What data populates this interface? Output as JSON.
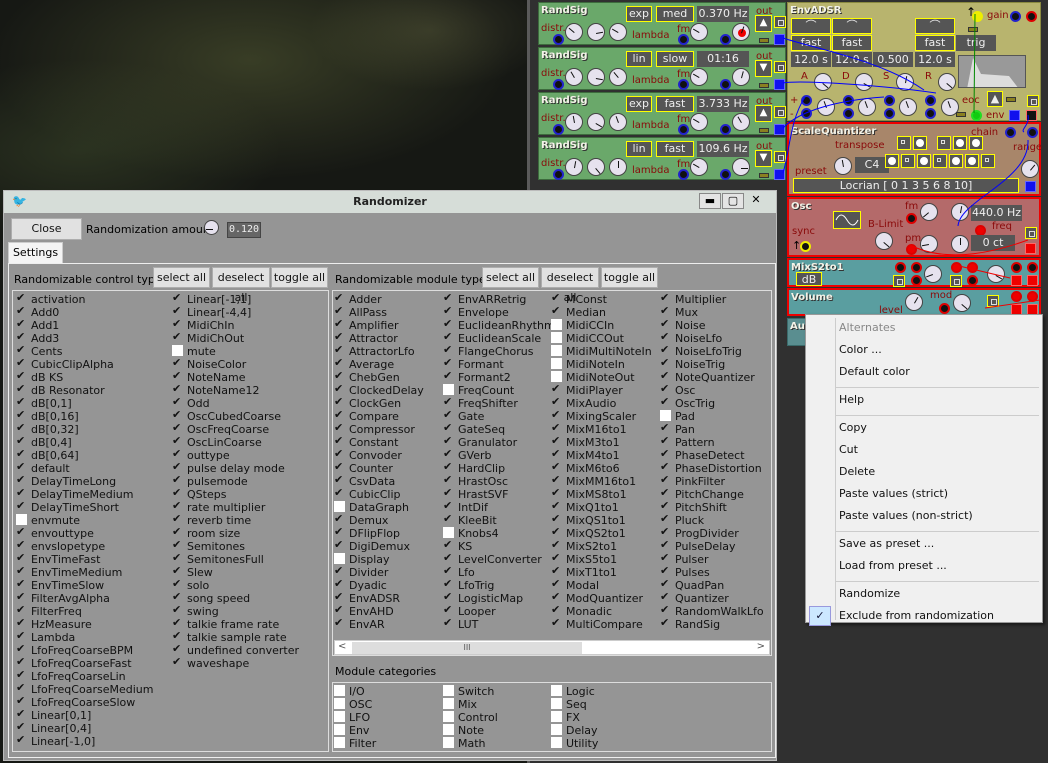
{
  "randsig": [
    {
      "title": "RandSig",
      "dist": "exp",
      "speed": "med",
      "value": "0.370 Hz",
      "distr": "distr.",
      "lambda": "lambda",
      "fm": "fm",
      "out": "out"
    },
    {
      "title": "RandSig",
      "dist": "lin",
      "speed": "slow",
      "value": "01:16",
      "distr": "distr.",
      "lambda": "lambda",
      "fm": "fm",
      "out": "out"
    },
    {
      "title": "RandSig",
      "dist": "exp",
      "speed": "fast",
      "value": "3.733 Hz",
      "distr": "distr.",
      "lambda": "lambda",
      "fm": "fm",
      "out": "out"
    },
    {
      "title": "RandSig",
      "dist": "lin",
      "speed": "fast",
      "value": "109.6 Hz",
      "distr": "distr.",
      "lambda": "lambda",
      "fm": "fm",
      "out": "out"
    }
  ],
  "envadsr": {
    "title": "EnvADSR",
    "modes": [
      "fast",
      "fast",
      "fast"
    ],
    "trig": "trig",
    "values": [
      "12.0 s",
      "12.0 s",
      "0.500",
      "12.0 s"
    ],
    "labels": [
      "A",
      "D",
      "S",
      "R"
    ],
    "gain": "gain",
    "eoc": "eoc",
    "env": "env",
    "plus": "+",
    "minus": "-"
  },
  "scalequantizer": {
    "title": "ScaleQuantizer",
    "chain": "chain",
    "transpose": "transpose",
    "note": "C4",
    "preset": "preset",
    "range": "range",
    "scale": "Locrian [ 0 1 3 5 6 8 10]"
  },
  "osc": {
    "title": "Osc",
    "blimit": "B-Limit",
    "fm": "fm",
    "pm": "pm",
    "freq_value": "440.0 Hz",
    "freq": "freq",
    "cents": "0 ct",
    "sync": "sync"
  },
  "mixs2to1": {
    "title": "MixS2to1",
    "unit": "dB"
  },
  "volume": {
    "title": "Volume",
    "level": "level",
    "mod": "mod"
  },
  "audio": {
    "title": "Au"
  },
  "dialog": {
    "title": "Randomizer",
    "close": "Close",
    "amount_label": "Randomization amount",
    "amount": "0.120",
    "tab": "Settings",
    "controls": {
      "title": "Randomizable control types",
      "select_all": "select all",
      "deselect_all": "deselect all",
      "toggle_all": "toggle all",
      "items": [
        [
          "activation",
          1
        ],
        [
          "Add0",
          1
        ],
        [
          "Add1",
          1
        ],
        [
          "Add3",
          1
        ],
        [
          "Cents",
          1
        ],
        [
          "CubicClipAlpha",
          1
        ],
        [
          "dB KS",
          1
        ],
        [
          "dB Resonator",
          1
        ],
        [
          "dB[0,1]",
          1
        ],
        [
          "dB[0,16]",
          1
        ],
        [
          "dB[0,32]",
          1
        ],
        [
          "dB[0,4]",
          1
        ],
        [
          "dB[0,64]",
          1
        ],
        [
          "default",
          1
        ],
        [
          "DelayTimeLong",
          1
        ],
        [
          "DelayTimeMedium",
          1
        ],
        [
          "DelayTimeShort",
          1
        ],
        [
          "envmute",
          0
        ],
        [
          "envouttype",
          1
        ],
        [
          "envslopetype",
          1
        ],
        [
          "EnvTimeFast",
          1
        ],
        [
          "EnvTimeMedium",
          1
        ],
        [
          "EnvTimeSlow",
          1
        ],
        [
          "FilterAvgAlpha",
          1
        ],
        [
          "FilterFreq",
          1
        ],
        [
          "HzMeasure",
          1
        ],
        [
          "Lambda",
          1
        ],
        [
          "LfoFreqCoarseBPM",
          1
        ],
        [
          "LfoFreqCoarseFast",
          1
        ],
        [
          "LfoFreqCoarseLin",
          1
        ],
        [
          "LfoFreqCoarseMedium",
          1
        ],
        [
          "LfoFreqCoarseSlow",
          1
        ],
        [
          "Linear[0,1]",
          1
        ],
        [
          "Linear[0,4]",
          1
        ],
        [
          "Linear[-1,0]",
          1
        ],
        [
          "Linear[-1,1]",
          1
        ],
        [
          "Linear[-4,4]",
          1
        ],
        [
          "MidiChIn",
          1
        ],
        [
          "MidiChOut",
          1
        ],
        [
          "mute",
          0
        ],
        [
          "NoiseColor",
          1
        ],
        [
          "NoteName",
          1
        ],
        [
          "NoteName12",
          1
        ],
        [
          "Odd",
          1
        ],
        [
          "OscCubedCoarse",
          1
        ],
        [
          "OscFreqCoarse",
          1
        ],
        [
          "OscLinCoarse",
          1
        ],
        [
          "outtype",
          1
        ],
        [
          "pulse delay mode",
          1
        ],
        [
          "pulsemode",
          1
        ],
        [
          "QSteps",
          1
        ],
        [
          "rate multiplier",
          1
        ],
        [
          "reverb time",
          1
        ],
        [
          "room size",
          1
        ],
        [
          "Semitones",
          1
        ],
        [
          "SemitonesFull",
          1
        ],
        [
          "Slew",
          1
        ],
        [
          "solo",
          1
        ],
        [
          "song speed",
          1
        ],
        [
          "swing",
          1
        ],
        [
          "talkie frame rate",
          1
        ],
        [
          "talkie sample rate",
          1
        ],
        [
          "undefined converter",
          1
        ],
        [
          "waveshape",
          1
        ]
      ]
    },
    "modules": {
      "title": "Randomizable module types",
      "select_all": "select all",
      "deselect_all": "deselect all",
      "toggle_all": "toggle all",
      "items": [
        [
          "Adder",
          1
        ],
        [
          "AllPass",
          1
        ],
        [
          "Amplifier",
          1
        ],
        [
          "Attractor",
          1
        ],
        [
          "AttractorLfo",
          1
        ],
        [
          "Average",
          1
        ],
        [
          "ChebGen",
          1
        ],
        [
          "ClockedDelay",
          1
        ],
        [
          "ClockGen",
          1
        ],
        [
          "Compare",
          1
        ],
        [
          "Compressor",
          1
        ],
        [
          "Constant",
          1
        ],
        [
          "Convoder",
          1
        ],
        [
          "Counter",
          1
        ],
        [
          "CsvData",
          1
        ],
        [
          "CubicClip",
          1
        ],
        [
          "DataGraph",
          0
        ],
        [
          "Demux",
          1
        ],
        [
          "DFlipFlop",
          1
        ],
        [
          "DigiDemux",
          1
        ],
        [
          "Display",
          0
        ],
        [
          "Divider",
          1
        ],
        [
          "Dyadic",
          1
        ],
        [
          "EnvADSR",
          1
        ],
        [
          "EnvAHD",
          1
        ],
        [
          "EnvAR",
          1
        ],
        [
          "EnvARRetrig",
          1
        ],
        [
          "Envelope",
          1
        ],
        [
          "EuclideanRhythm",
          1
        ],
        [
          "EuclideanScale",
          1
        ],
        [
          "FlangeChorus",
          1
        ],
        [
          "Formant",
          1
        ],
        [
          "Formant2",
          1
        ],
        [
          "FreqCount",
          0
        ],
        [
          "FreqShifter",
          1
        ],
        [
          "Gate",
          1
        ],
        [
          "GateSeq",
          1
        ],
        [
          "Granulator",
          1
        ],
        [
          "GVerb",
          1
        ],
        [
          "HardClip",
          1
        ],
        [
          "HrastOsc",
          1
        ],
        [
          "HrastSVF",
          1
        ],
        [
          "IntDif",
          1
        ],
        [
          "KleeBit",
          1
        ],
        [
          "Knobs4",
          0
        ],
        [
          "KS",
          1
        ],
        [
          "LevelConverter",
          1
        ],
        [
          "Lfo",
          1
        ],
        [
          "LfoTrig",
          1
        ],
        [
          "LogisticMap",
          1
        ],
        [
          "Looper",
          1
        ],
        [
          "LUT",
          1
        ],
        [
          "MConst",
          1
        ],
        [
          "Median",
          1
        ],
        [
          "MidiCCIn",
          0
        ],
        [
          "MidiCCOut",
          0
        ],
        [
          "MidiMultiNoteIn",
          0
        ],
        [
          "MidiNoteIn",
          0
        ],
        [
          "MidiNoteOut",
          0
        ],
        [
          "MidiPlayer",
          1
        ],
        [
          "MixAudio",
          1
        ],
        [
          "MixingScaler",
          1
        ],
        [
          "MixM16to1",
          1
        ],
        [
          "MixM3to1",
          1
        ],
        [
          "MixM4to1",
          1
        ],
        [
          "MixM6to6",
          1
        ],
        [
          "MixMM16to1",
          1
        ],
        [
          "MixMS8to1",
          1
        ],
        [
          "MixQ1to1",
          1
        ],
        [
          "MixQS1to1",
          1
        ],
        [
          "MixQS2to1",
          1
        ],
        [
          "MixS2to1",
          1
        ],
        [
          "MixS5to1",
          1
        ],
        [
          "MixT1to1",
          1
        ],
        [
          "Modal",
          1
        ],
        [
          "ModQuantizer",
          1
        ],
        [
          "Monadic",
          1
        ],
        [
          "MultiCompare",
          1
        ],
        [
          "Multiplier",
          1
        ],
        [
          "Mux",
          1
        ],
        [
          "Noise",
          1
        ],
        [
          "NoiseLfo",
          1
        ],
        [
          "NoiseLfoTrig",
          1
        ],
        [
          "NoiseTrig",
          1
        ],
        [
          "NoteQuantizer",
          1
        ],
        [
          "Osc",
          1
        ],
        [
          "OscTrig",
          1
        ],
        [
          "Pad",
          0
        ],
        [
          "Pan",
          1
        ],
        [
          "Pattern",
          1
        ],
        [
          "PhaseDetect",
          1
        ],
        [
          "PhaseDistortion",
          1
        ],
        [
          "PinkFilter",
          1
        ],
        [
          "PitchChange",
          1
        ],
        [
          "PitchShift",
          1
        ],
        [
          "Pluck",
          1
        ],
        [
          "ProgDivider",
          1
        ],
        [
          "PulseDelay",
          1
        ],
        [
          "Pulser",
          1
        ],
        [
          "Pulses",
          1
        ],
        [
          "QuadPan",
          1
        ],
        [
          "Quantizer",
          1
        ],
        [
          "RandomWalkLfo",
          1
        ],
        [
          "RandSig",
          1
        ]
      ]
    },
    "categories": {
      "title": "Module categories",
      "items": [
        [
          "I/O",
          0
        ],
        [
          "OSC",
          0
        ],
        [
          "LFO",
          0
        ],
        [
          "Env",
          0
        ],
        [
          "Filter",
          0
        ],
        [
          "Switch",
          0
        ],
        [
          "Mix",
          0
        ],
        [
          "Control",
          0
        ],
        [
          "Note",
          0
        ],
        [
          "Math",
          0
        ],
        [
          "Logic",
          0
        ],
        [
          "Seq",
          0
        ],
        [
          "FX",
          0
        ],
        [
          "Delay",
          0
        ],
        [
          "Utility",
          0
        ]
      ]
    }
  },
  "context_menu": {
    "items": [
      {
        "label": "Alternates",
        "disabled": true
      },
      {
        "label": "Color ..."
      },
      {
        "label": "Default color"
      },
      {
        "sep": true
      },
      {
        "label": "Help"
      },
      {
        "sep": true
      },
      {
        "label": "Copy"
      },
      {
        "label": "Cut"
      },
      {
        "label": "Delete"
      },
      {
        "label": "Paste values (strict)"
      },
      {
        "label": "Paste values (non-strict)"
      },
      {
        "sep": true
      },
      {
        "label": "Save as preset ..."
      },
      {
        "label": "Load from preset ..."
      },
      {
        "sep": true
      },
      {
        "label": "Randomize"
      },
      {
        "label": "Exclude from randomization",
        "checked": true
      }
    ]
  },
  "colors": {
    "randsig": "#6aa86a",
    "envadsr": "#b8b46e",
    "scalequantizer": "#a8866a",
    "osc": "#b46a6a",
    "mix": "#5a9ea0",
    "accent_yellow": "#ffff00",
    "wire_blue": "#0000ff",
    "wire_red": "#ff0000"
  }
}
